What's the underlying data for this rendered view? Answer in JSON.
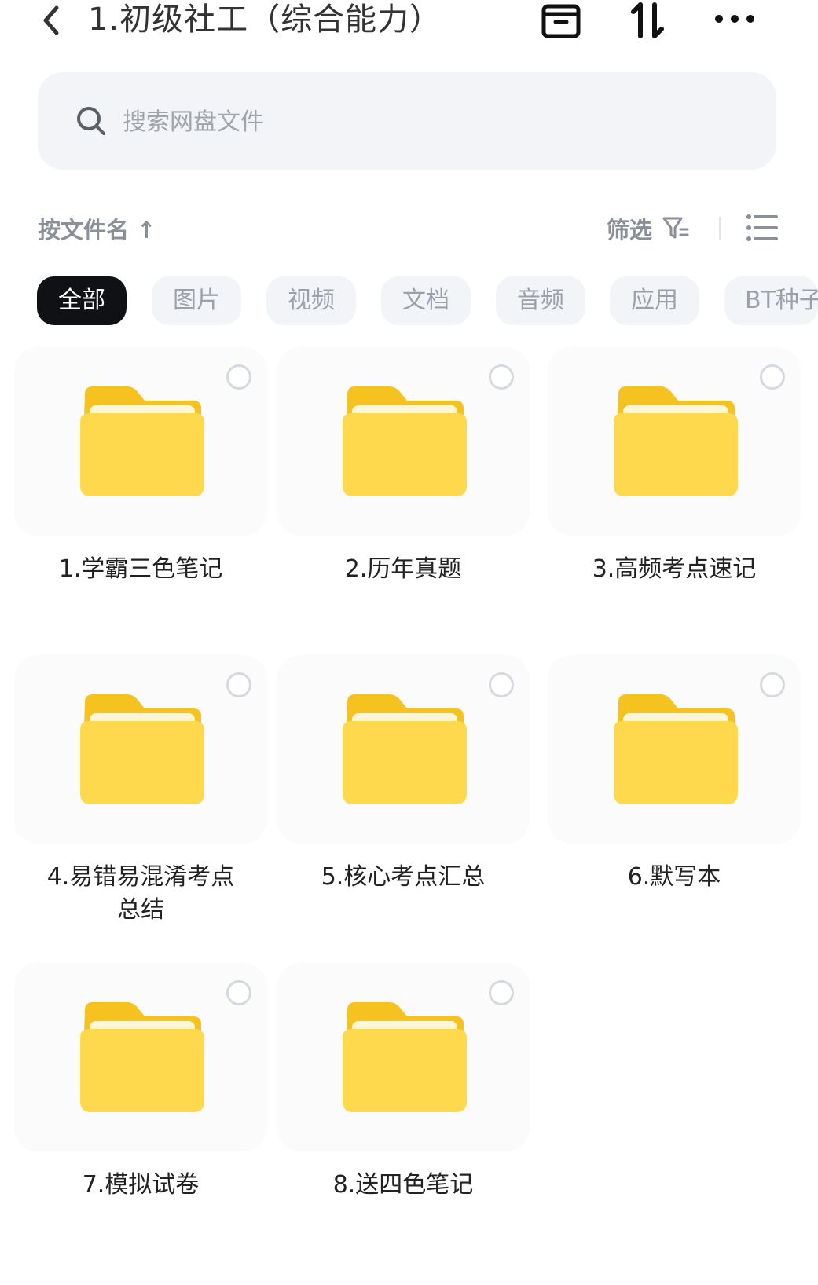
{
  "header": {
    "title": "1.初级社工（综合能力）"
  },
  "search": {
    "placeholder": "搜索网盘文件"
  },
  "toolbar": {
    "sort_label": "按文件名 ↑",
    "filter_label": "筛选"
  },
  "tabs": [
    {
      "label": "全部",
      "active": true
    },
    {
      "label": "图片"
    },
    {
      "label": "视频"
    },
    {
      "label": "文档"
    },
    {
      "label": "音频"
    },
    {
      "label": "应用"
    },
    {
      "label": "BT种子"
    }
  ],
  "folders": [
    {
      "name": "1.学霸三色笔记"
    },
    {
      "name": "2.历年真题"
    },
    {
      "name": "3.高频考点速记"
    },
    {
      "name": "4.易错易混淆考点总结"
    },
    {
      "name": "5.核心考点汇总"
    },
    {
      "name": "6.默写本"
    },
    {
      "name": "7.模拟试卷"
    },
    {
      "name": "8.送四色笔记"
    }
  ],
  "colors": {
    "accent": "#0f1115",
    "folder": "#ffd94d",
    "folder_dark": "#f5c21f"
  }
}
